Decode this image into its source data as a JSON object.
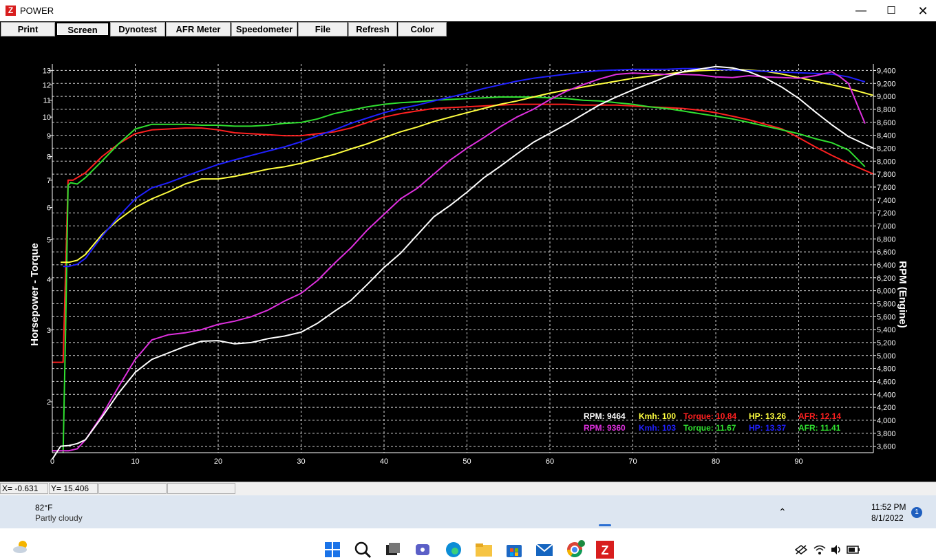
{
  "window": {
    "title": "POWER",
    "logo": "Z",
    "controls": [
      "minimize-icon",
      "maximize-icon",
      "close-icon"
    ]
  },
  "toolbar": {
    "buttons": [
      "Print",
      "Screen",
      "Dynotest",
      "AFR Meter",
      "Speedometer",
      "File",
      "Refresh",
      "Color"
    ],
    "active": "Screen"
  },
  "status": {
    "x": "X= -0.631",
    "y": "Y= 15.406"
  },
  "readouts": {
    "row1": [
      {
        "label": "RPM:",
        "value": "9464",
        "color": "#ffffff"
      },
      {
        "label": "Kmh:",
        "value": "100",
        "color": "#ffff40"
      },
      {
        "label": "Torque:",
        "value": "10.84",
        "color": "#ff2020"
      },
      {
        "label": "HP:",
        "value": "13.26",
        "color": "#ffff40"
      },
      {
        "label": "AFR:",
        "value": "12.14",
        "color": "#ff2020"
      }
    ],
    "row2": [
      {
        "label": "RPM:",
        "value": "9360",
        "color": "#e030e0"
      },
      {
        "label": "Kmh:",
        "value": "103",
        "color": "#2020ff"
      },
      {
        "label": "Torque:",
        "value": "11.67",
        "color": "#30e030"
      },
      {
        "label": "HP:",
        "value": "13.37",
        "color": "#2020ff"
      },
      {
        "label": "AFR:",
        "value": "11.41",
        "color": "#30e030"
      }
    ]
  },
  "taskbar": {
    "weather_temp": "82°F",
    "weather_text": "Partly cloudy",
    "time": "11:52 PM",
    "date": "8/1/2022",
    "notification_count": "1",
    "icons": [
      "windows-start-icon",
      "search-icon",
      "task-view-icon",
      "teams-icon",
      "edge-icon",
      "file-explorer-icon",
      "store-icon",
      "mail-icon",
      "chrome-icon",
      "dyno-app-icon"
    ]
  },
  "chart_data": {
    "type": "line",
    "xlabel": "",
    "ylabel": "Horsepower - Torque",
    "y2label": "RPM (Engine)",
    "xlim": [
      0,
      99
    ],
    "ylim": [
      1.5,
      13.5
    ],
    "yscale": "log",
    "y2lim": [
      3500,
      9500
    ],
    "xticks": [
      0,
      10,
      20,
      30,
      40,
      50,
      60,
      70,
      80,
      90
    ],
    "yticks": [
      2,
      3,
      4,
      5,
      6,
      7,
      8,
      9,
      10,
      11,
      12,
      13
    ],
    "y2ticks": [
      3600,
      3800,
      4000,
      4200,
      4400,
      4600,
      4800,
      5000,
      5200,
      5400,
      5600,
      5800,
      6000,
      6200,
      6400,
      6600,
      6800,
      7000,
      7200,
      7400,
      7600,
      7800,
      8000,
      8200,
      8400,
      8600,
      8800,
      9000,
      9200,
      9400
    ],
    "y2tick_labels": [
      "3,600",
      "3,800",
      "4,000",
      "4,200",
      "4,400",
      "4,600",
      "4,800",
      "5,000",
      "5,200",
      "5,400",
      "5,600",
      "5,800",
      "6,000",
      "6,200",
      "6,400",
      "6,600",
      "6,800",
      "7,000",
      "7,200",
      "7,400",
      "7,600",
      "7,800",
      "8,000",
      "8,200",
      "8,400",
      "8,600",
      "8,800",
      "9,000",
      "9,200",
      "9,400"
    ],
    "grid": true,
    "series": [
      {
        "color": "#ff2020",
        "axis": "left",
        "x": [
          0,
          1.3,
          1.9,
          2.5,
          4,
          6,
          8,
          10,
          12,
          14,
          16,
          18,
          20,
          22,
          24,
          26,
          28,
          30,
          32,
          34,
          36,
          38,
          40,
          42,
          44,
          46,
          48,
          50,
          52,
          54,
          56,
          58,
          60,
          62,
          64,
          66,
          68,
          70,
          72,
          74,
          76,
          78,
          80,
          82,
          84,
          86,
          88,
          90,
          92,
          94,
          96,
          99
        ],
        "y": [
          2.5,
          2.5,
          7.0,
          7.0,
          7.3,
          8.0,
          8.6,
          9.1,
          9.3,
          9.35,
          9.4,
          9.4,
          9.3,
          9.15,
          9.1,
          9.05,
          9.0,
          9.0,
          9.1,
          9.2,
          9.4,
          9.7,
          10.0,
          10.2,
          10.35,
          10.5,
          10.55,
          10.6,
          10.65,
          10.7,
          10.75,
          10.75,
          10.75,
          10.75,
          10.7,
          10.7,
          10.7,
          10.65,
          10.6,
          10.55,
          10.5,
          10.4,
          10.25,
          10.05,
          9.85,
          9.6,
          9.35,
          8.9,
          8.45,
          8.05,
          7.7,
          7.25
        ]
      },
      {
        "color": "#30e030",
        "axis": "left",
        "x": [
          1.3,
          1.6,
          1.9,
          2.2,
          3,
          4,
          6,
          8,
          10,
          12,
          14,
          16,
          18,
          20,
          22,
          24,
          26,
          28,
          30,
          32,
          34,
          36,
          38,
          40,
          42,
          44,
          46,
          48,
          50,
          52,
          54,
          56,
          58,
          60,
          62,
          64,
          66,
          68,
          70,
          72,
          74,
          76,
          78,
          80,
          82,
          84,
          86,
          88,
          90,
          92,
          94,
          96,
          98
        ],
        "y": [
          1.5,
          3.0,
          6.8,
          6.9,
          6.85,
          7.1,
          7.8,
          8.6,
          9.35,
          9.6,
          9.6,
          9.6,
          9.55,
          9.55,
          9.5,
          9.5,
          9.55,
          9.65,
          9.7,
          9.9,
          10.2,
          10.4,
          10.6,
          10.75,
          10.85,
          10.9,
          11.0,
          11.05,
          11.1,
          11.15,
          11.2,
          11.2,
          11.2,
          11.15,
          11.1,
          11.0,
          10.95,
          10.85,
          10.75,
          10.6,
          10.5,
          10.35,
          10.2,
          10.05,
          9.9,
          9.7,
          9.5,
          9.3,
          9.1,
          8.85,
          8.65,
          8.3,
          7.55
        ]
      },
      {
        "color": "#ffff40",
        "axis": "left",
        "x": [
          1,
          1.5,
          2,
          3,
          4,
          6,
          8,
          10,
          12,
          14,
          16,
          18,
          20,
          22,
          24,
          26,
          28,
          30,
          32,
          34,
          36,
          38,
          40,
          42,
          44,
          46,
          48,
          50,
          52,
          54,
          56,
          58,
          60,
          62,
          64,
          66,
          68,
          70,
          72,
          74,
          76,
          78,
          80,
          82,
          84,
          86,
          88,
          90,
          92,
          94,
          96,
          99
        ],
        "y": [
          4.4,
          4.4,
          4.4,
          4.45,
          4.6,
          5.15,
          5.6,
          6.0,
          6.3,
          6.55,
          6.85,
          7.05,
          7.05,
          7.15,
          7.3,
          7.45,
          7.55,
          7.7,
          7.9,
          8.1,
          8.35,
          8.6,
          8.9,
          9.2,
          9.45,
          9.75,
          10.0,
          10.25,
          10.5,
          10.75,
          10.95,
          11.2,
          11.45,
          11.65,
          11.85,
          12.05,
          12.25,
          12.45,
          12.6,
          12.75,
          12.9,
          13.0,
          13.05,
          13.1,
          13.05,
          12.95,
          12.75,
          12.5,
          12.25,
          12.0,
          11.75,
          11.3
        ]
      },
      {
        "color": "#2020ff",
        "axis": "left",
        "x": [
          1.3,
          1.6,
          2,
          3,
          4,
          6,
          8,
          10,
          12,
          14,
          16,
          18,
          20,
          22,
          24,
          26,
          28,
          30,
          32,
          34,
          36,
          38,
          40,
          42,
          44,
          46,
          48,
          50,
          52,
          54,
          56,
          58,
          60,
          62,
          64,
          66,
          68,
          70,
          72,
          74,
          76,
          78,
          80,
          82,
          84,
          86,
          88,
          90,
          92,
          94,
          96,
          98
        ],
        "y": [
          4.3,
          4.3,
          4.3,
          4.35,
          4.5,
          5.1,
          5.7,
          6.3,
          6.7,
          6.9,
          7.15,
          7.4,
          7.65,
          7.85,
          8.05,
          8.25,
          8.45,
          8.7,
          9.0,
          9.3,
          9.65,
          9.95,
          10.25,
          10.5,
          10.7,
          10.95,
          11.2,
          11.45,
          11.75,
          12.0,
          12.25,
          12.45,
          12.6,
          12.75,
          12.9,
          13.0,
          13.05,
          13.1,
          13.1,
          13.1,
          13.15,
          13.15,
          13.1,
          13.05,
          13.0,
          12.95,
          12.9,
          12.85,
          12.8,
          12.75,
          12.55,
          12.2
        ]
      },
      {
        "color": "#e030e0",
        "axis": "right",
        "x": [
          0,
          2,
          3,
          4,
          6,
          8,
          10,
          12,
          14,
          16,
          18,
          20,
          22,
          24,
          26,
          28,
          30,
          32,
          34,
          36,
          38,
          40,
          42,
          44,
          46,
          48,
          50,
          52,
          54,
          56,
          58,
          60,
          62,
          64,
          66,
          68,
          70,
          72,
          74,
          76,
          78,
          80,
          82,
          84,
          86,
          88,
          90,
          92,
          94,
          95,
          96,
          98
        ],
        "y": [
          3530,
          3530,
          3560,
          3700,
          4080,
          4520,
          4940,
          5240,
          5320,
          5350,
          5400,
          5480,
          5530,
          5600,
          5700,
          5840,
          5960,
          6160,
          6420,
          6660,
          6940,
          7180,
          7420,
          7580,
          7800,
          8020,
          8200,
          8360,
          8530,
          8680,
          8800,
          8950,
          9080,
          9180,
          9270,
          9340,
          9360,
          9350,
          9340,
          9340,
          9330,
          9300,
          9290,
          9320,
          9300,
          9290,
          9280,
          9320,
          9380,
          9300,
          9200,
          8580
        ]
      },
      {
        "color": "#ffffff",
        "axis": "right",
        "x": [
          0,
          1,
          2,
          3,
          4,
          6,
          8,
          10,
          12,
          14,
          16,
          18,
          20,
          22,
          24,
          26,
          28,
          30,
          32,
          34,
          36,
          38,
          40,
          42,
          44,
          46,
          48,
          50,
          52,
          54,
          56,
          58,
          60,
          62,
          64,
          66,
          68,
          70,
          72,
          74,
          76,
          78,
          80,
          82,
          84,
          86,
          88,
          90,
          92,
          94,
          96,
          99
        ],
        "y": [
          3400,
          3600,
          3610,
          3640,
          3700,
          4050,
          4420,
          4740,
          4940,
          5040,
          5140,
          5220,
          5230,
          5180,
          5200,
          5260,
          5300,
          5360,
          5500,
          5680,
          5850,
          6100,
          6360,
          6580,
          6860,
          7140,
          7320,
          7520,
          7740,
          7920,
          8110,
          8290,
          8430,
          8570,
          8720,
          8870,
          8990,
          9100,
          9200,
          9300,
          9380,
          9420,
          9460,
          9440,
          9380,
          9280,
          9140,
          8970,
          8760,
          8560,
          8380,
          8200
        ]
      }
    ]
  }
}
